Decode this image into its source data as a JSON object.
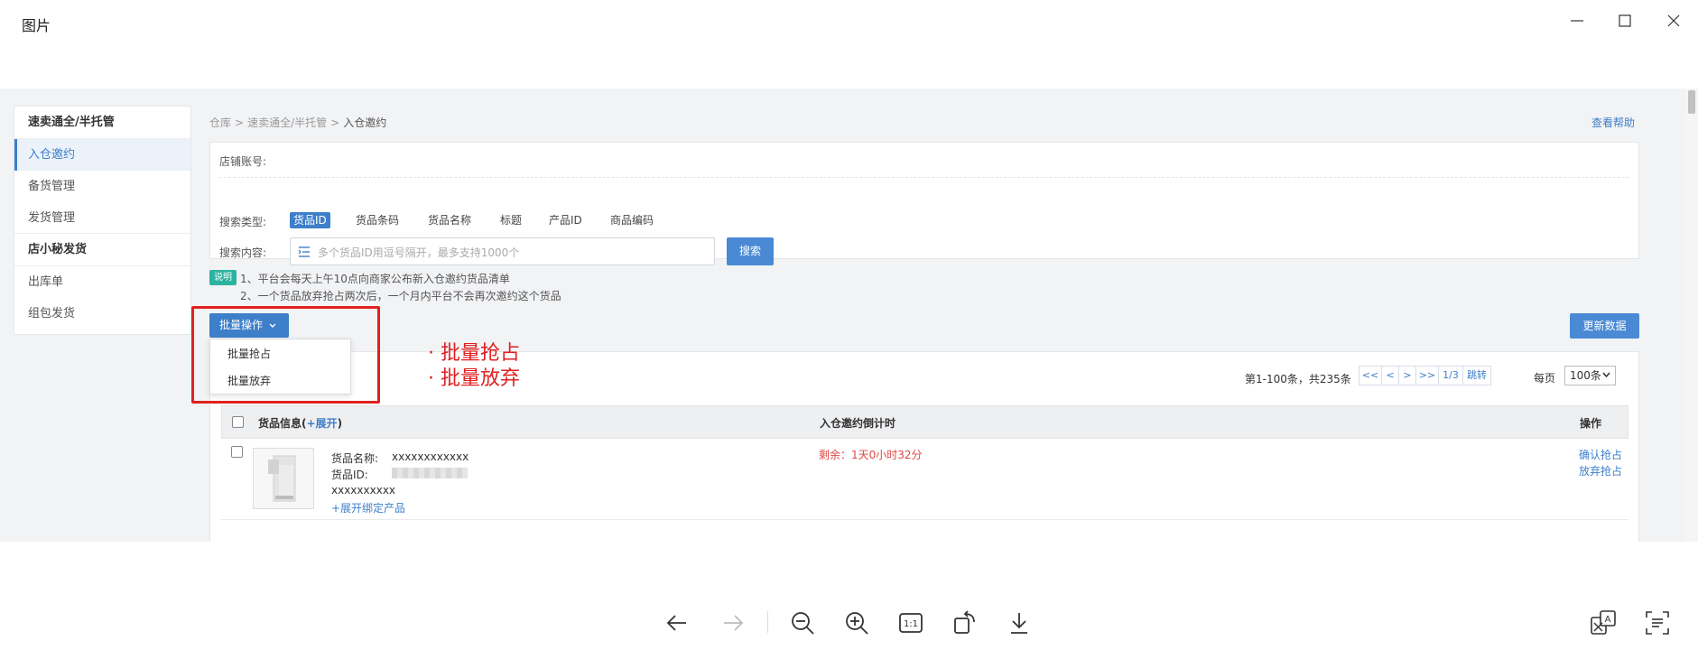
{
  "window": {
    "title": "图片"
  },
  "sidebar": {
    "groups": [
      {
        "label": "速卖通全/半托管",
        "items": [
          {
            "label": "入仓邀约"
          },
          {
            "label": "备货管理"
          },
          {
            "label": "发货管理"
          }
        ]
      },
      {
        "label": "店小秘发货",
        "items": [
          {
            "label": "出库单"
          },
          {
            "label": "组包发货"
          }
        ]
      }
    ]
  },
  "breadcrumb": {
    "root": "仓库",
    "mid": "速卖通全/半托管",
    "current": "入仓邀约"
  },
  "help_link": "查看帮助",
  "search": {
    "shop_label": "店铺账号:",
    "type_label": "搜索类型:",
    "types": [
      "货品ID",
      "货品条码",
      "货品名称",
      "标题",
      "产品ID",
      "商品编码"
    ],
    "content_label": "搜索内容:",
    "placeholder": "多个货品ID用逗号隔开，最多支持1000个",
    "button": "搜索"
  },
  "notice": {
    "badge": "说明",
    "line1": "1、平台会每天上午10点向商家公布新入仓邀约货品清单",
    "line2": "2、一个货品放弃抢占两次后，一个月内平台不会再次邀约这个货品"
  },
  "batch": {
    "button": "批量操作",
    "menu": [
      "批量抢占",
      "批量放弃"
    ]
  },
  "refresh_button": "更新数据",
  "annotation": {
    "line1": "· 批量抢占",
    "line2": "· 批量放弃"
  },
  "pagination": {
    "info": "第1-100条，共235条",
    "first": "<<",
    "prev": "<",
    "next": ">",
    "last": ">>",
    "page": "1/3",
    "jump": "跳转",
    "per_label": "每页",
    "per_value": "100条"
  },
  "table": {
    "col_goods": "货品信息(",
    "col_goods_expand": "+展开",
    "col_goods_close": ")",
    "col_countdown": "入仓邀约倒计时",
    "col_ops": "操作",
    "rows": [
      {
        "name_label": "货品名称:",
        "name_value": "xxxxxxxxxxxx",
        "id_label": "货品ID:",
        "extra": "xxxxxxxxxx",
        "expand_link": "+展开绑定产品",
        "countdown": "剩余：1天0小时32分",
        "op_claim": "确认抢占",
        "op_abandon": "放弃抢占"
      }
    ]
  },
  "colors": {
    "primary": "#3d7fc9",
    "annotation": "#e02020",
    "badge": "#2bb3a0"
  },
  "toolbar_icons": [
    "arrow-left-icon",
    "arrow-right-icon",
    "zoom-out-icon",
    "zoom-in-icon",
    "actual-size-icon",
    "rotate-icon",
    "download-icon",
    "translate-icon",
    "text-extract-icon"
  ]
}
